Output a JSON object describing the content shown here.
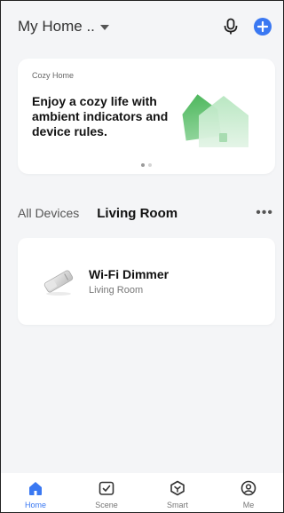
{
  "header": {
    "home_name": "My Home ..",
    "icons": [
      "microphone-icon",
      "plus-icon"
    ]
  },
  "banner": {
    "tag": "Cozy Home",
    "text": "Enjoy a cozy life with ambient indicators and device rules.",
    "page_count": 2,
    "active_page": 1
  },
  "rooms": {
    "tabs": [
      "All Devices",
      "Living Room"
    ],
    "active_tab": "Living Room"
  },
  "device": {
    "name": "Wi-Fi Dimmer",
    "room": "Living Room"
  },
  "nav": {
    "items": [
      {
        "label": "Home",
        "icon": "home-icon",
        "active": true
      },
      {
        "label": "Scene",
        "icon": "checkbox-icon",
        "active": false
      },
      {
        "label": "Smart",
        "icon": "smart-icon",
        "active": false
      },
      {
        "label": "Me",
        "icon": "profile-icon",
        "active": false
      }
    ]
  },
  "colors": {
    "accent": "#3a78f2",
    "background": "#f4f5f7",
    "banner_green": "#5cc06a"
  }
}
